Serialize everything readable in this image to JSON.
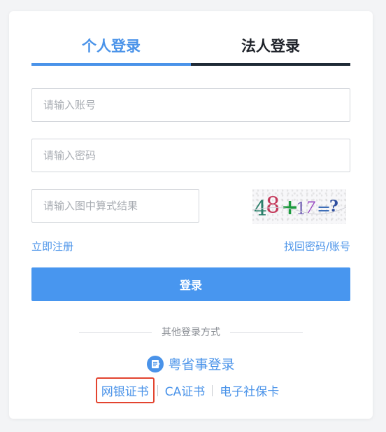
{
  "tabs": [
    {
      "label": "个人登录",
      "active": true
    },
    {
      "label": "法人登录",
      "active": false
    }
  ],
  "form": {
    "account_placeholder": "请输入账号",
    "password_placeholder": "请输入密码",
    "captcha_placeholder": "请输入图中算式结果",
    "captcha_text": "48+17=?"
  },
  "links": {
    "register": "立即注册",
    "forgot": "找回密码/账号"
  },
  "login_button": "登录",
  "other_methods": {
    "divider_text": "其他登录方式",
    "yss_label": "粤省事登录",
    "yss_icon": "document-icon",
    "methods": [
      "网银证书",
      "CA证书",
      "电子社保卡"
    ]
  },
  "colors": {
    "accent": "#4a93e9",
    "button": "#4896ef",
    "highlight_border": "#e3442f"
  }
}
